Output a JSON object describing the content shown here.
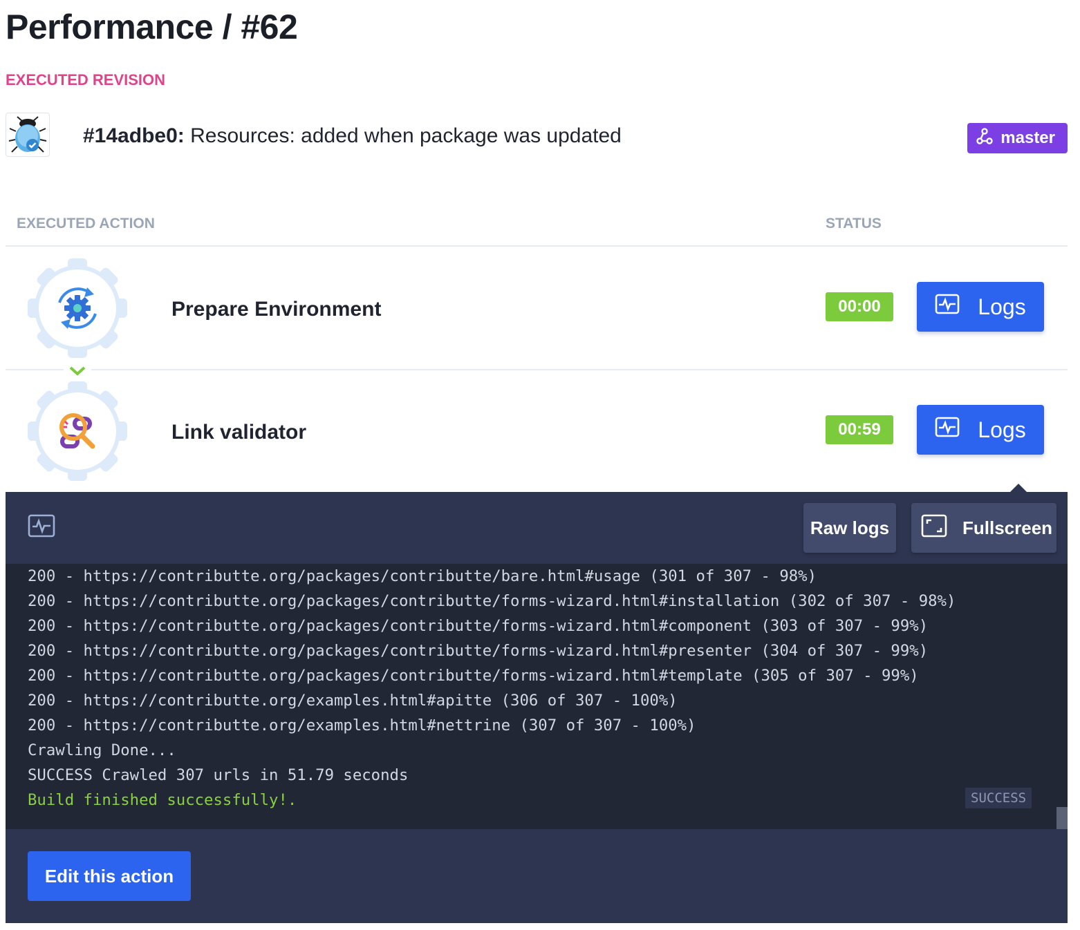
{
  "page": {
    "title": "Performance / #62",
    "revision_label": "EXECUTED REVISION"
  },
  "commit": {
    "hash": "#14adbe0:",
    "message": "Resources: added when package was updated",
    "avatar_icon": "ladybug-avatar-icon",
    "branch": "master",
    "branch_icon": "branch-icon",
    "branch_color": "#7b3fe4"
  },
  "table": {
    "col_action": "EXECUTED ACTION",
    "col_status": "STATUS"
  },
  "actions": [
    {
      "name": "Prepare Environment",
      "icon": "gear-sync-icon",
      "duration": "00:00",
      "logs_label": "Logs"
    },
    {
      "name": "Link validator",
      "icon": "link-search-icon",
      "duration": "00:59",
      "logs_label": "Logs"
    }
  ],
  "log_panel": {
    "raw_logs_label": "Raw logs",
    "fullscreen_label": "Fullscreen",
    "lines": [
      "200 - https://contributte.org/packages/contributte/bare.html#usage (301 of 307 - 98%)",
      "200 - https://contributte.org/packages/contributte/forms-wizard.html#installation (302 of 307 - 98%)",
      "200 - https://contributte.org/packages/contributte/forms-wizard.html#component (303 of 307 - 99%)",
      "200 - https://contributte.org/packages/contributte/forms-wizard.html#presenter (304 of 307 - 99%)",
      "200 - https://contributte.org/packages/contributte/forms-wizard.html#template (305 of 307 - 99%)",
      "200 - https://contributte.org/examples.html#apitte (306 of 307 - 100%)",
      "200 - https://contributte.org/examples.html#nettrine (307 of 307 - 100%)",
      "Crawling Done...",
      "SUCCESS Crawled 307 urls in 51.79 seconds"
    ],
    "final_line": "Build finished successfully!.",
    "status_chip": "SUCCESS",
    "edit_label": "Edit this action"
  },
  "colors": {
    "accent_blue": "#2c64f0",
    "success_green": "#7ccb3c",
    "revision_pink": "#e0438b",
    "panel_bg": "#2e3550",
    "log_bg": "#212735"
  }
}
